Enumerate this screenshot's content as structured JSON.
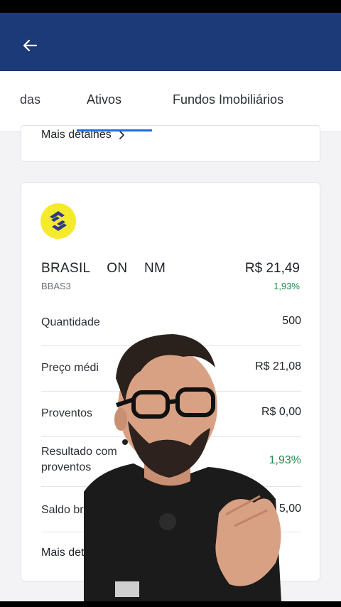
{
  "appbar": {
    "back_icon": "arrow-left-icon",
    "bg_color": "#1c3a78"
  },
  "tabs": [
    {
      "label": "das",
      "state": "partial"
    },
    {
      "label": "Ativos",
      "state": "active"
    },
    {
      "label": "Fundos Imobiliários",
      "state": "inactive"
    }
  ],
  "top_card": {
    "more_label": "Mais detalhes",
    "chevron_icon": "chevron-right-icon"
  },
  "asset": {
    "logo_icon": "banco-do-brasil-logo",
    "name": "BRASIL ON NM",
    "price": "R$ 21,49",
    "ticker": "BBAS3",
    "change": "1,93%",
    "rows": [
      {
        "label": "Quantidade",
        "value": "500"
      },
      {
        "label": "Preço médi",
        "value": "R$ 21,08"
      },
      {
        "label": "Proventos",
        "value": "R$ 0,00"
      },
      {
        "label": "Resultado com proventos",
        "value": "1,93%"
      },
      {
        "label": "Saldo br",
        "value": "5,00"
      }
    ],
    "more_label": "Mais det"
  },
  "colors": {
    "accent": "#1c6fe0",
    "positive": "#1f8a4c",
    "logo_yellow": "#f6ea2c",
    "logo_blue": "#2a3a8f"
  }
}
